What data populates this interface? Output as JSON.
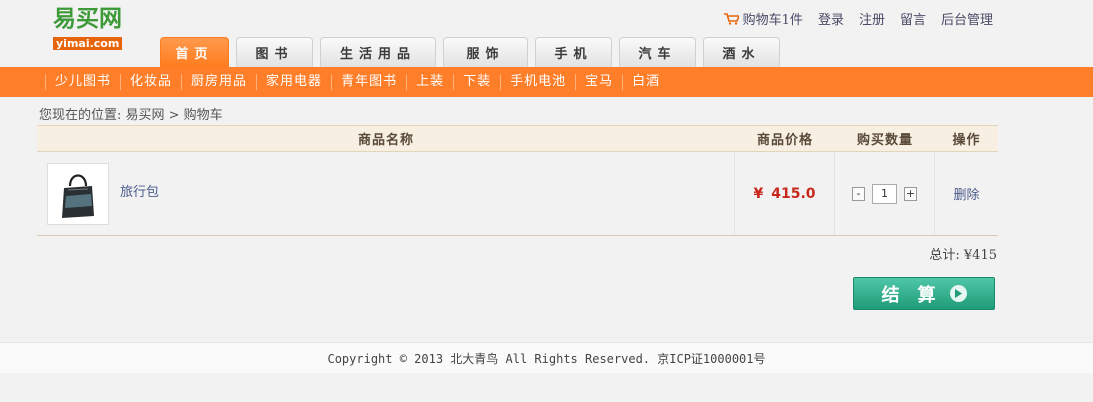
{
  "logo": {
    "top": "易买网",
    "bottom": "yimai.com"
  },
  "toplinks": {
    "cart": "购物车1件",
    "login": "登录",
    "register": "注册",
    "message": "留言",
    "admin": "后台管理"
  },
  "tabs": [
    "首页",
    "图书",
    "生活用品",
    "服饰",
    "手机",
    "汽车",
    "酒水"
  ],
  "categories": [
    "少儿图书",
    "化妆品",
    "厨房用品",
    "家用电器",
    "青年图书",
    "上装",
    "下装",
    "手机电池",
    "宝马",
    "白酒"
  ],
  "breadcrumb": "您现在的位置: 易买网 > 购物车",
  "table": {
    "headers": {
      "name": "商品名称",
      "price": "商品价格",
      "qty": "购买数量",
      "op": "操作"
    },
    "rows": [
      {
        "name": "旅行包",
        "price_symbol": "¥",
        "price": "415.0",
        "qty": "1",
        "minus": "-",
        "plus": "+",
        "action": "删除"
      }
    ]
  },
  "total": "总计: ¥415",
  "checkout_label": "结算",
  "footer": "Copyright © 2013 北大青鸟 All Rights Reserved. 京ICP证1000001号"
}
